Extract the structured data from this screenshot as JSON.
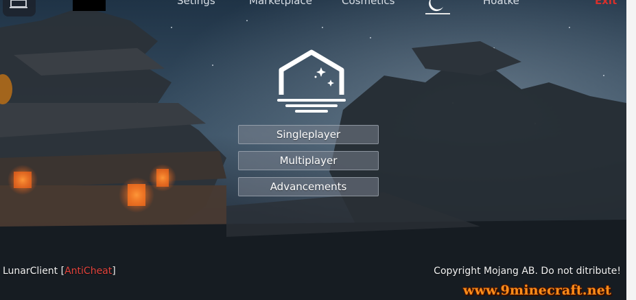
{
  "nav": {
    "items": [
      {
        "label": "Setings"
      },
      {
        "label": "Marketplace"
      },
      {
        "label": "Cosmetics"
      },
      {
        "label": "Hoatke"
      },
      {
        "label": "Exit"
      }
    ]
  },
  "menu": {
    "singleplayer": "Singleplayer",
    "multiplayer": "Multiplayer",
    "advancements": "Advancements"
  },
  "footer": {
    "client_name": "LunarClient",
    "bracket_open": " [",
    "anticheat": "AntiCheat",
    "bracket_close": "]",
    "copyright": "Copyright Mojang AB. Do not ditribute!"
  },
  "watermark": "www.9minecraft.net",
  "colors": {
    "accent_red": "#e2433c",
    "exit_red": "#d8302b",
    "button_bg": "#78808c",
    "watermark_orange": "#ff8d1a"
  },
  "icons": [
    "menu-icon",
    "moon-icon",
    "lunar-logo-icon"
  ]
}
